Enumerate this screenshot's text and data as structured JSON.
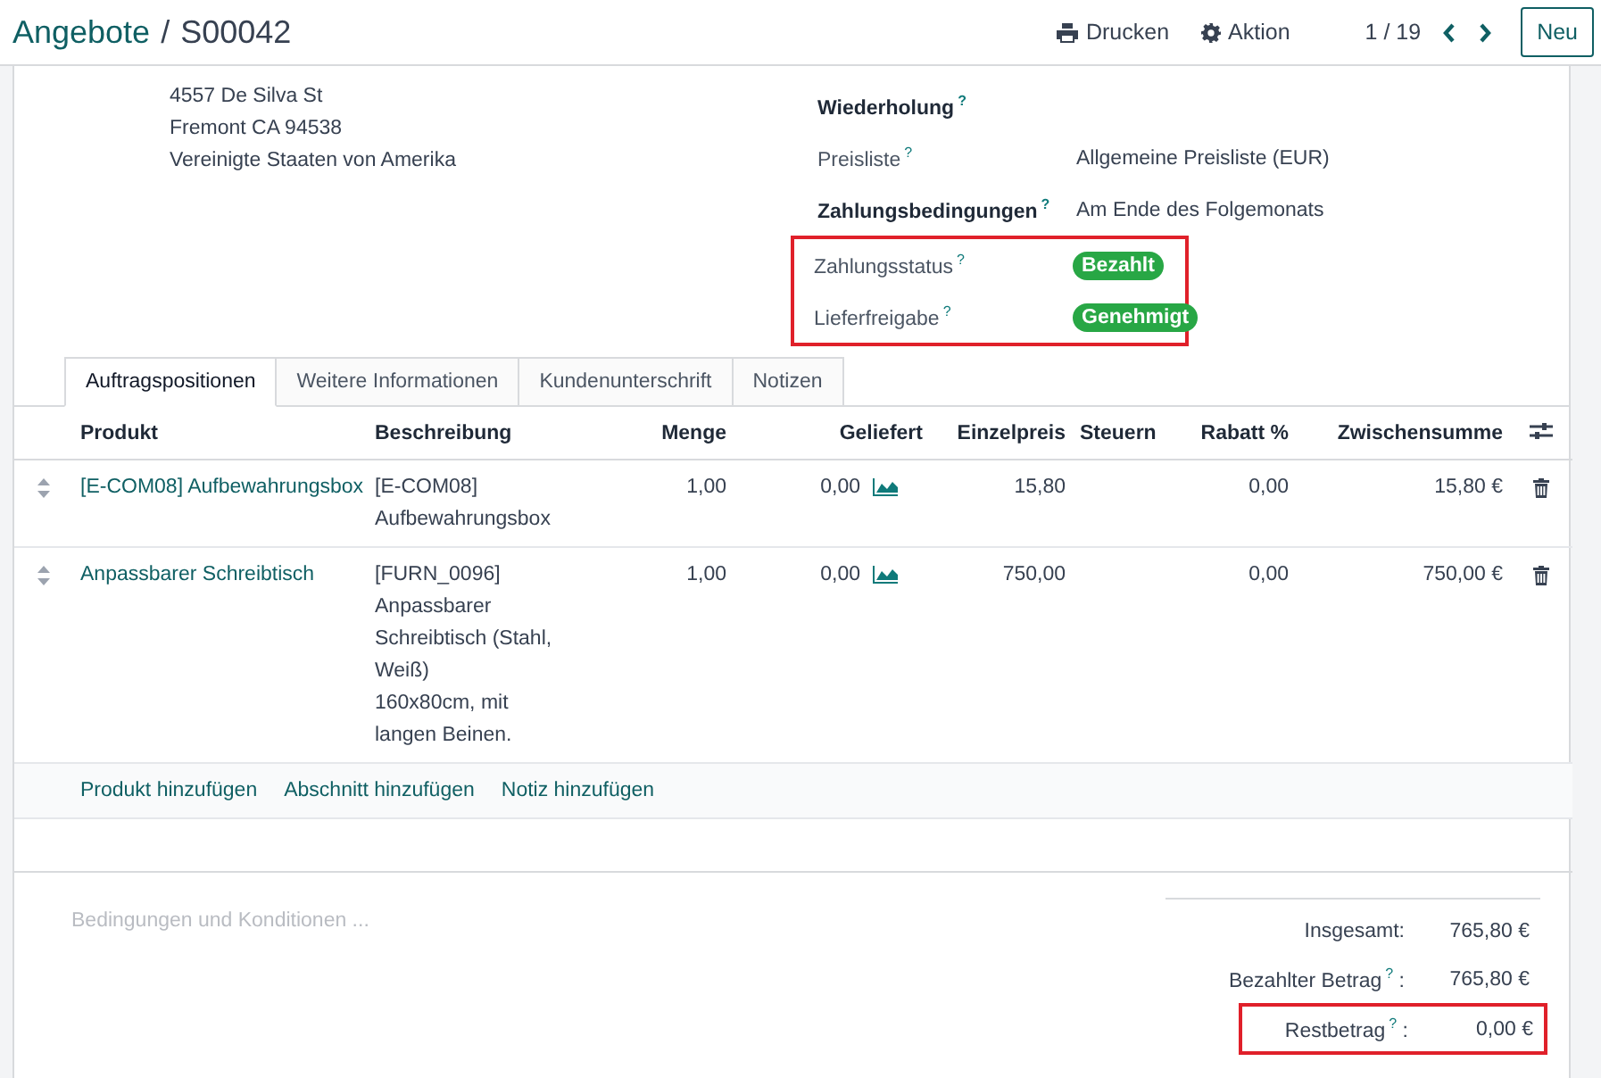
{
  "breadcrumb": {
    "parent": "Angebote",
    "separator": "/",
    "current": "S00042"
  },
  "actions": [
    {
      "kind": "print",
      "label": "Drucken"
    },
    {
      "kind": "gear",
      "label": "Aktion"
    }
  ],
  "pager": {
    "value": "1 / 19"
  },
  "new_button": {
    "label": "Neu"
  },
  "address_lines": [
    "4557 De Silva St",
    "Fremont CA 94538",
    "Vereinigte Staaten von Amerika"
  ],
  "field_groups": [
    {
      "highlighted": false,
      "fields": [
        {
          "label": "Wiederholung",
          "emphasized": true,
          "help": "?"
        },
        {
          "label": "Preisliste",
          "emphasized": false,
          "help": "?",
          "kind": "text",
          "value": "Allgemeine Preisliste (EUR)"
        },
        {
          "label": "Zahlungsbedingungen",
          "emphasized": true,
          "help": "?",
          "kind": "text",
          "value": "Am Ende des Folgemonats"
        }
      ]
    },
    {
      "highlighted": true,
      "fields": [
        {
          "label": "Zahlungsstatus",
          "emphasized": false,
          "help": "?",
          "kind": "badge",
          "value": "Bezahlt"
        },
        {
          "label": "Lieferfreigabe",
          "emphasized": false,
          "help": "?",
          "kind": "badge",
          "value": "Genehmigt"
        }
      ]
    }
  ],
  "tabs": [
    {
      "label": "Auftragspositionen",
      "selected": true
    },
    {
      "label": "Weitere Informationen",
      "selected": false
    },
    {
      "label": "Kundenunterschrift",
      "selected": false
    },
    {
      "label": "Notizen",
      "selected": false
    }
  ],
  "table": {
    "columns": [
      "Produkt",
      "Beschreibung",
      "Menge",
      "Geliefert",
      "Einzelpreis",
      "Steuern",
      "Rabatt %",
      "Zwischensumme"
    ],
    "rows": [
      {
        "product": "[E-COM08] Aufbewahrungsbox",
        "description": [
          "[E-COM08]",
          "Aufbewahrungsbox"
        ],
        "quantity": "1,00",
        "delivered": "0,00",
        "unit_price": "15,80",
        "discount": "0,00",
        "subtotal": "15,80 €"
      },
      {
        "product": "Anpassbarer Schreibtisch",
        "description": [
          "[FURN_0096]",
          "Anpassbarer",
          "Schreibtisch (Stahl,",
          "Weiß)",
          "160x80cm, mit",
          "langen Beinen."
        ],
        "quantity": "1,00",
        "delivered": "0,00",
        "unit_price": "750,00",
        "discount": "0,00",
        "subtotal": "750,00 €"
      }
    ],
    "add_links": [
      "Produkt hinzufügen",
      "Abschnitt hinzufügen",
      "Notiz hinzufügen"
    ]
  },
  "terms": {
    "placeholder": "Bedingungen und Konditionen ..."
  },
  "totals": [
    {
      "label": "Insgesamt:",
      "value": "765,80 €",
      "highlighted": false
    },
    {
      "label": "Bezahlter Betrag",
      "help": "?",
      "colon": ":",
      "value": "765,80 €",
      "highlighted": false
    },
    {
      "label": "Restbetrag",
      "help": "?",
      "colon": ":",
      "value": "0,00 €",
      "highlighted": true
    }
  ]
}
